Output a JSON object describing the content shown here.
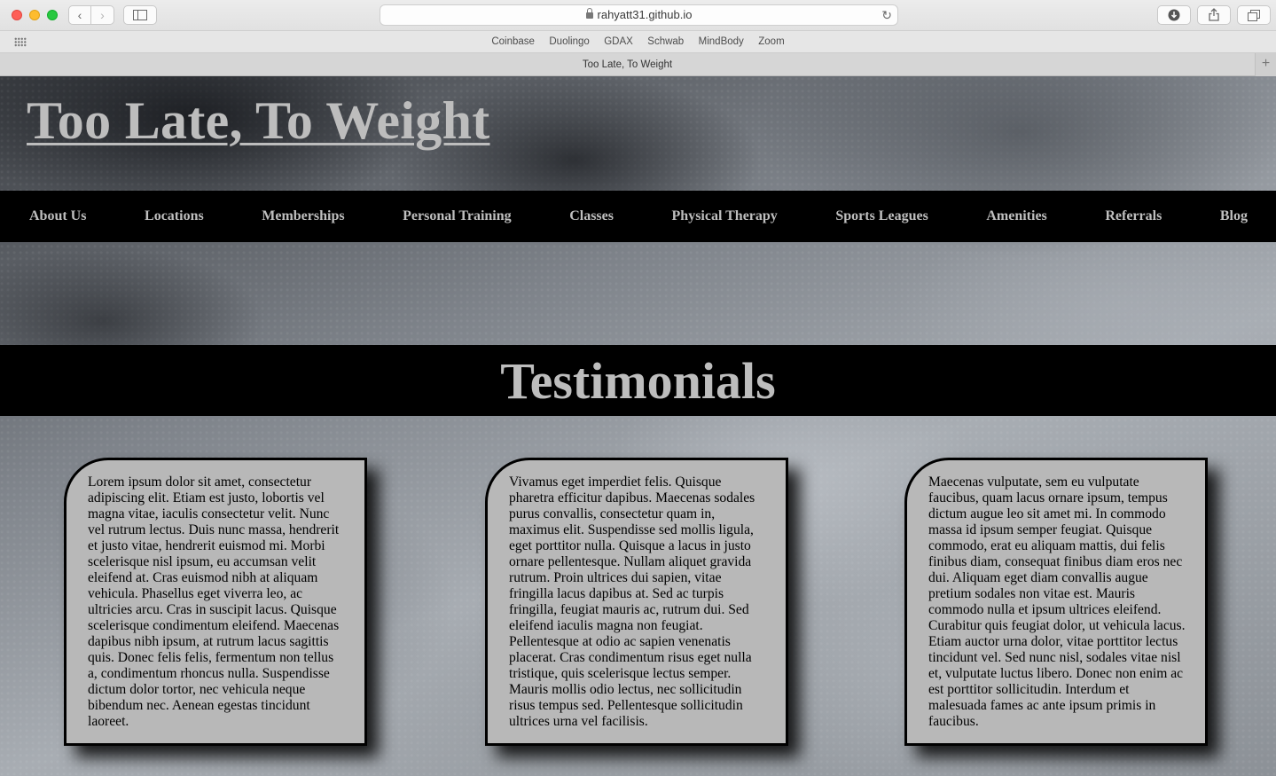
{
  "browser": {
    "url": "rahyatt31.github.io",
    "tab_title": "Too Late, To Weight",
    "favorites": [
      "Coinbase",
      "Duolingo",
      "GDAX",
      "Schwab",
      "MindBody",
      "Zoom"
    ]
  },
  "site": {
    "title": "Too Late, To Weight",
    "nav": [
      "About Us",
      "Locations",
      "Memberships",
      "Personal Training",
      "Classes",
      "Physical Therapy",
      "Sports Leagues",
      "Amenities",
      "Referrals",
      "Blog"
    ],
    "section_title": "Testimonials",
    "testimonials": [
      "Lorem ipsum dolor sit amet, consectetur adipiscing elit. Etiam est justo, lobortis vel magna vitae, iaculis consectetur velit. Nunc vel rutrum lectus. Duis nunc massa, hendrerit et justo vitae, hendrerit euismod mi. Morbi scelerisque nisl ipsum, eu accumsan velit eleifend at. Cras euismod nibh at aliquam vehicula. Phasellus eget viverra leo, ac ultricies arcu. Cras in suscipit lacus. Quisque scelerisque condimentum eleifend. Maecenas dapibus nibh ipsum, at rutrum lacus sagittis quis. Donec felis felis, fermentum non tellus a, condimentum rhoncus nulla. Suspendisse dictum dolor tortor, nec vehicula neque bibendum nec. Aenean egestas tincidunt laoreet.",
      "Vivamus eget imperdiet felis. Quisque pharetra efficitur dapibus. Maecenas sodales purus convallis, consectetur quam in, maximus elit. Suspendisse sed mollis ligula, eget porttitor nulla. Quisque a lacus in justo ornare pellentesque. Nullam aliquet gravida rutrum. Proin ultrices dui sapien, vitae fringilla lacus dapibus at. Sed ac turpis fringilla, feugiat mauris ac, rutrum dui. Sed eleifend iaculis magna non feugiat. Pellentesque at odio ac sapien venenatis placerat. Cras condimentum risus eget nulla tristique, quis scelerisque lectus semper. Mauris mollis odio lectus, nec sollicitudin risus tempus sed. Pellentesque sollicitudin ultrices urna vel facilisis.",
      "Maecenas vulputate, sem eu vulputate faucibus, quam lacus ornare ipsum, tempus dictum augue leo sit amet mi. In commodo massa id ipsum semper feugiat. Quisque commodo, erat eu aliquam mattis, dui felis finibus diam, consequat finibus diam eros nec dui. Aliquam eget diam convallis augue pretium sodales non vitae est. Mauris commodo nulla et ipsum ultrices eleifend. Curabitur quis feugiat dolor, ut vehicula lacus. Etiam auctor urna dolor, vitae porttitor lectus tincidunt vel. Sed nunc nisl, sodales vitae nisl et, vulputate luctus libero. Donec non enim ac est porttitor sollicitudin. Interdum et malesuada fames ac ante ipsum primis in faucibus."
    ]
  },
  "icons": {
    "back": "chevron-left-icon",
    "forward": "chevron-right-icon",
    "sidebar": "sidebar-icon",
    "lock": "lock-icon",
    "reload": "reload-icon",
    "download": "download-icon",
    "share": "share-icon",
    "tabs": "tabs-overview-icon",
    "grid": "grid-icon",
    "new_tab": "plus-icon"
  },
  "colors": {
    "nav_bg": "#000000",
    "title_text": "#bdbdbd",
    "card_bg": "#b8b8b8"
  }
}
